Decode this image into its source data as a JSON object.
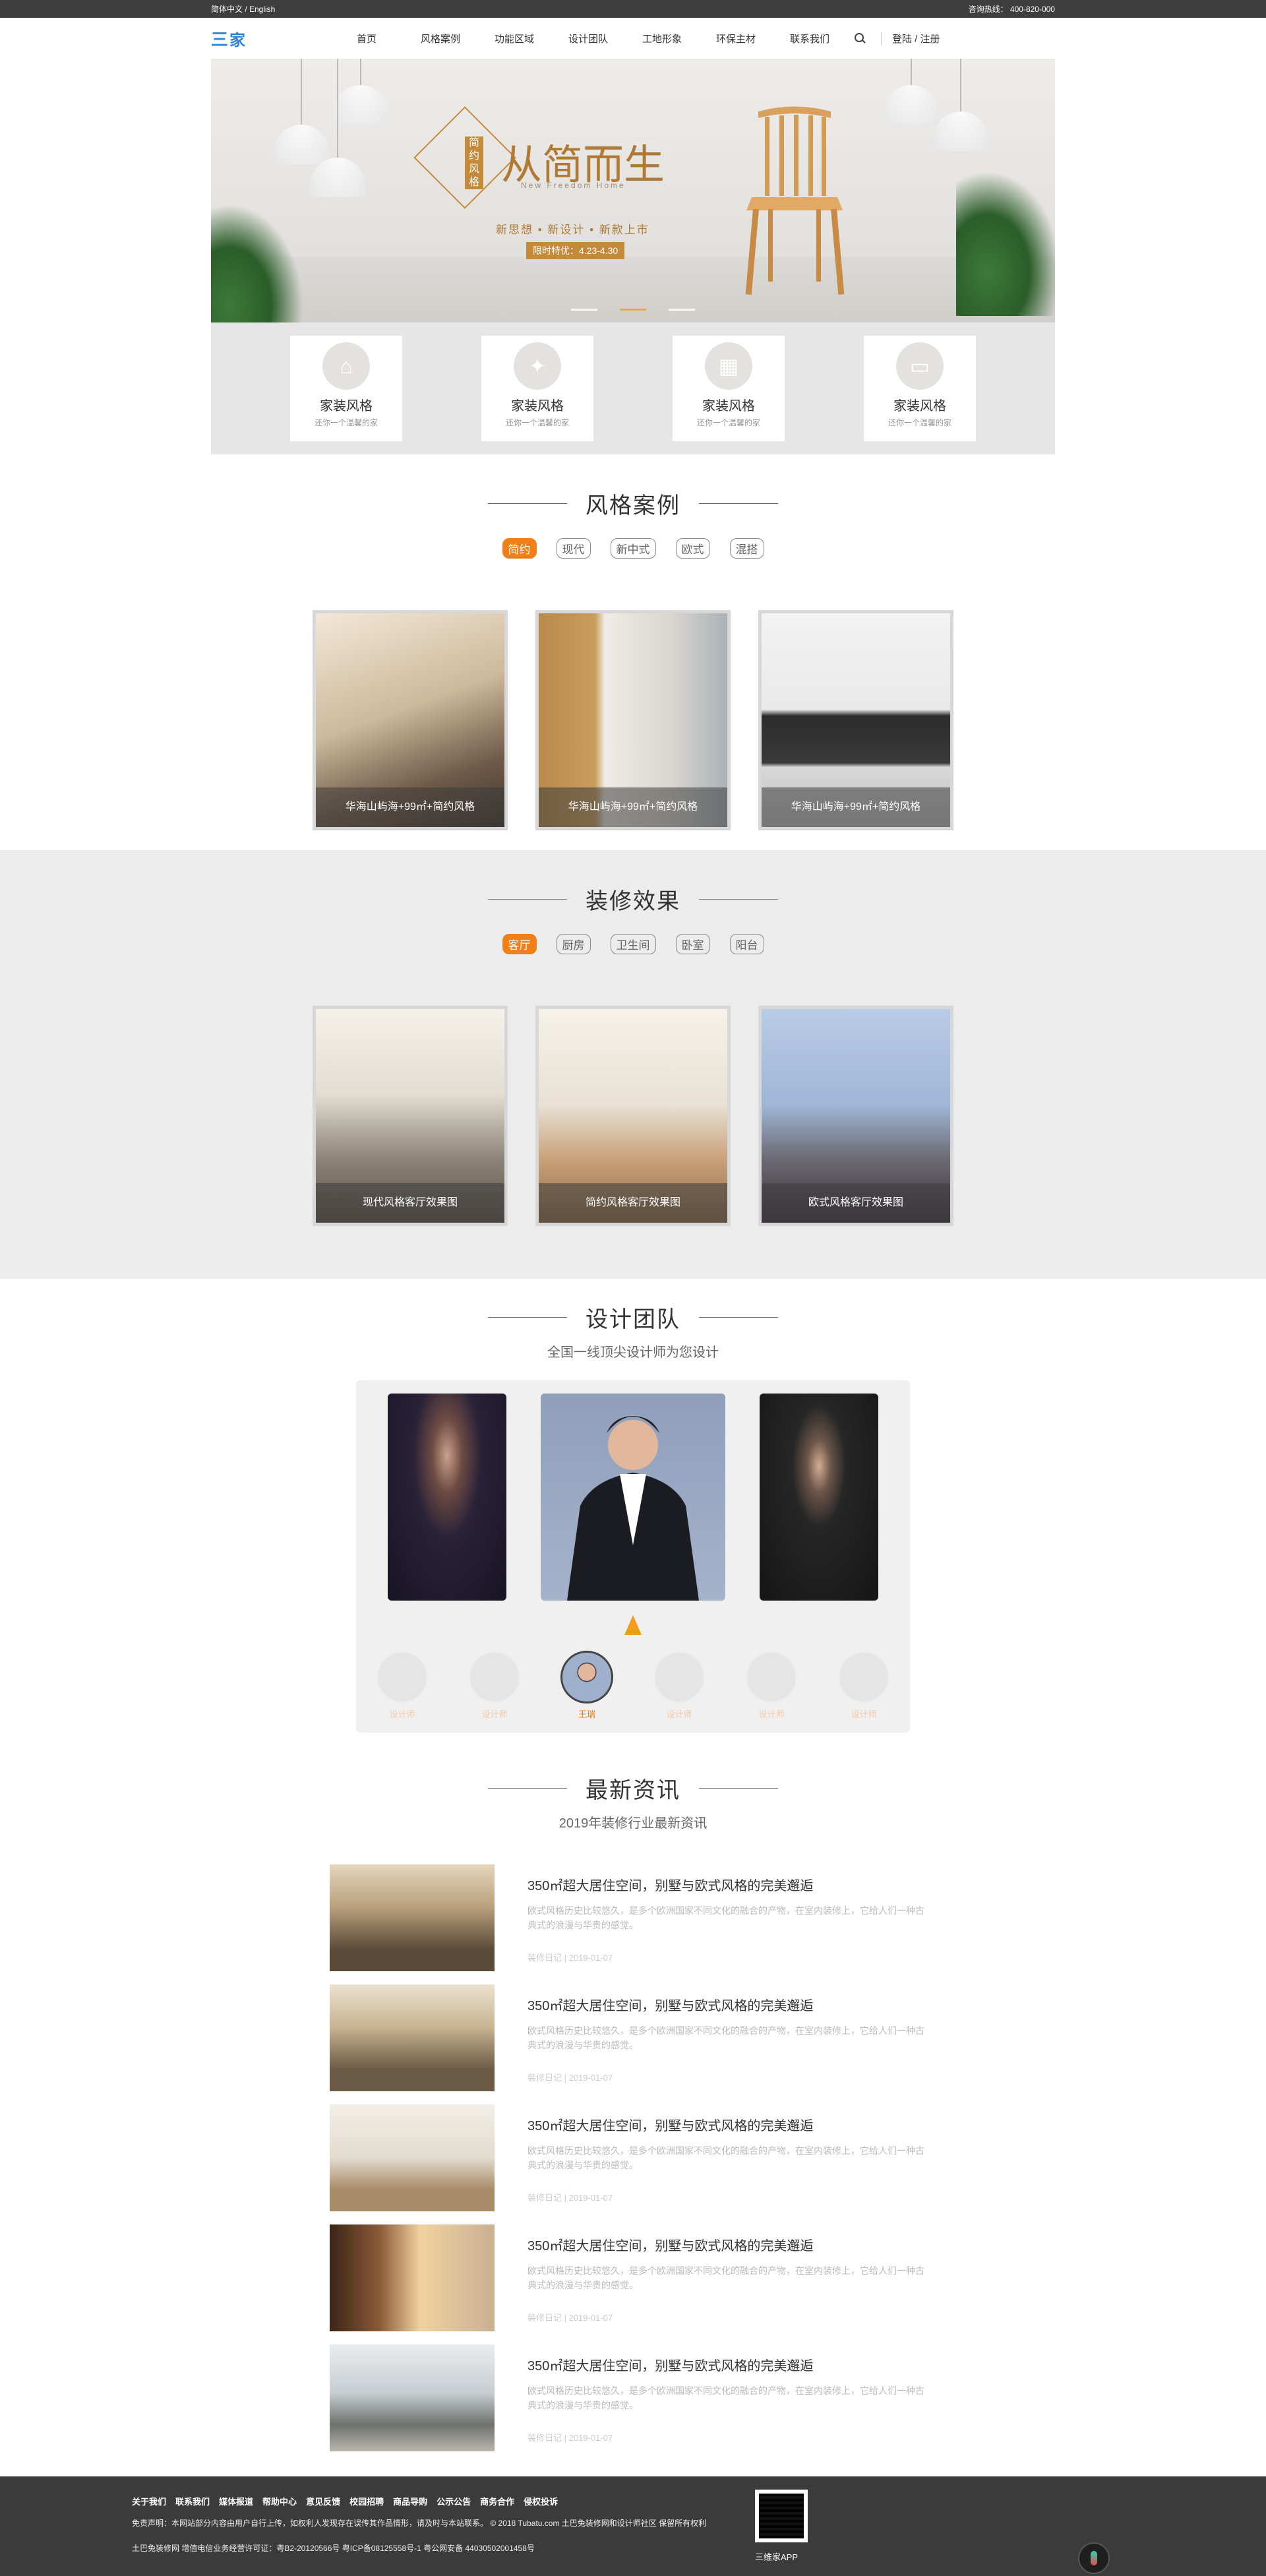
{
  "topbar": {
    "lang": "简体中文 / English",
    "hotline": "咨询热线：  400-820-000"
  },
  "header": {
    "nav": [
      "首页",
      "风格案例",
      "功能区域",
      "设计团队",
      "工地形象",
      "环保主材",
      "联系我们"
    ],
    "login": "登陆 / 注册"
  },
  "logo": {
    "mark": "三",
    "name": "家"
  },
  "banner": {
    "badge": "简约风格",
    "title": "从简而生",
    "sub_en": "New Freedom Home",
    "sub_cn": "新思想 • 新设计 • 新款上市",
    "tag": "限时特优：4.23-4.30",
    "slides": 3,
    "active": 2
  },
  "features": [
    {
      "title": "家装风格",
      "desc": "还你一个温馨的家"
    },
    {
      "title": "家装风格",
      "desc": "还你一个温馨的家"
    },
    {
      "title": "家装风格",
      "desc": "还你一个温馨的家"
    },
    {
      "title": "家装风格",
      "desc": "还你一个温馨的家"
    }
  ],
  "style_cases": {
    "title": "风格案例",
    "tabs": [
      "简约",
      "现代",
      "新中式",
      "欧式",
      "混搭"
    ],
    "active_tab": 0,
    "cards": [
      "华海山屿海+99㎡+简约风格",
      "华海山屿海+99㎡+简约风格",
      "华海山屿海+99㎡+简约风格"
    ]
  },
  "effects": {
    "title": "装修效果",
    "tabs": [
      "客厅",
      "厨房",
      "卫生间",
      "卧室",
      "阳台"
    ],
    "active_tab": 0,
    "cards": [
      "现代风格客厅效果图",
      "简约风格客厅效果图",
      "欧式风格客厅效果图"
    ]
  },
  "team": {
    "title": "设计团队",
    "subtitle": "全国一线顶尖设计师为您设计",
    "members": [
      "设计师",
      "设计师",
      "王瑞",
      "设计师",
      "设计师",
      "设计师"
    ],
    "active": 2
  },
  "news": {
    "title": "最新资讯",
    "subtitle": "2019年装修行业最新资讯",
    "items": [
      {
        "title": "350㎡超大居住空间，别墅与欧式风格的完美邂逅",
        "desc": "欧式风格历史比较悠久，是多个欧洲国家不同文化的融合的产物，在室内装修上，它给人们一种古典式的浪漫与华贵的感觉。",
        "date": "装修日记 | 2019-01-07"
      },
      {
        "title": "350㎡超大居住空间，别墅与欧式风格的完美邂逅",
        "desc": "欧式风格历史比较悠久，是多个欧洲国家不同文化的融合的产物，在室内装修上，它给人们一种古典式的浪漫与华贵的感觉。",
        "date": "装修日记 | 2019-01-07"
      },
      {
        "title": "350㎡超大居住空间，别墅与欧式风格的完美邂逅",
        "desc": "欧式风格历史比较悠久，是多个欧洲国家不同文化的融合的产物，在室内装修上，它给人们一种古典式的浪漫与华贵的感觉。",
        "date": "装修日记 | 2019-01-07"
      },
      {
        "title": "350㎡超大居住空间，别墅与欧式风格的完美邂逅",
        "desc": "欧式风格历史比较悠久，是多个欧洲国家不同文化的融合的产物，在室内装修上，它给人们一种古典式的浪漫与华贵的感觉。",
        "date": "装修日记 | 2019-01-07"
      },
      {
        "title": "350㎡超大居住空间，别墅与欧式风格的完美邂逅",
        "desc": "欧式风格历史比较悠久，是多个欧洲国家不同文化的融合的产物，在室内装修上，它给人们一种古典式的浪漫与华贵的感觉。",
        "date": "装修日记 | 2019-01-07"
      }
    ]
  },
  "footer": {
    "links": [
      "关于我们",
      "联系我们",
      "媒体报道",
      "帮助中心",
      "意见反馈",
      "校园招聘",
      "商品导购",
      "公示公告",
      "商务合作",
      "侵权投诉"
    ],
    "disclaimer": "免责声明：本网站部分内容由用户自行上传，如权利人发现存在误传其作品情形，请及时与本站联系。  © 2018 Tubatu.com  土巴兔装修网和设计师社区 保留所有权利",
    "licence": "土巴兔装修网  增值电信业务经营许可证：粤B2-20120566号     粤ICP备08125558号-1   粤公网安备  44030502001458号",
    "qr_label": "三维家APP"
  },
  "colors": {
    "accent": "#ef7f19",
    "brand": "#2a86d6",
    "footer_bg": "#3b3b3b",
    "topbar_bg": "#3e3e3e"
  }
}
